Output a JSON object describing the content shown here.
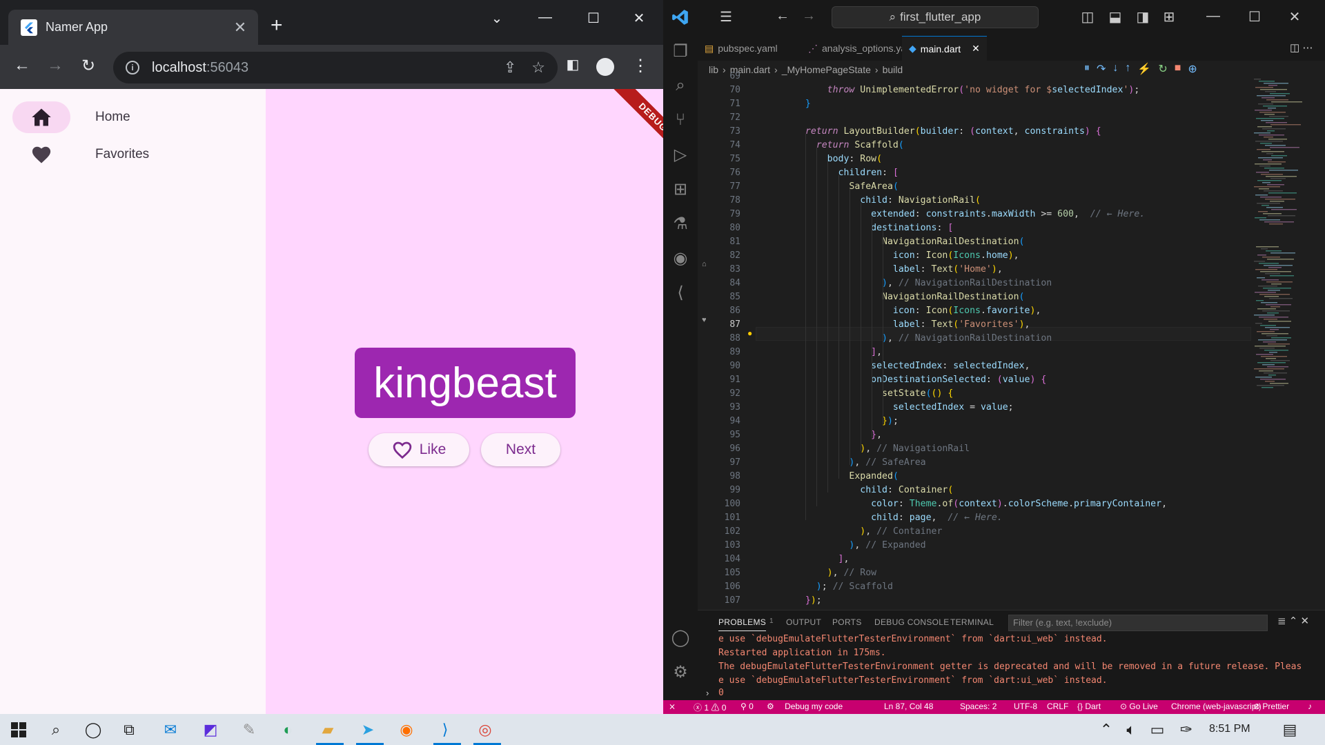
{
  "browser": {
    "tab_title": "Namer App",
    "url_host": "localhost",
    "url_port": ":56043"
  },
  "app": {
    "rail": [
      {
        "label": "Home",
        "icon": "home-icon",
        "selected": true
      },
      {
        "label": "Favorites",
        "icon": "favorite-icon",
        "selected": false
      }
    ],
    "word": "kingbeast",
    "like_label": "Like",
    "next_label": "Next",
    "debug_banner": "DEBUG",
    "colors": {
      "primary": "#9d27b0",
      "container": "#ffd6fe",
      "indicator": "#f8d8f2"
    }
  },
  "vscode": {
    "search": "first_flutter_app",
    "tabs": [
      "pubspec.yaml",
      "analysis_options.yaml",
      "main.dart"
    ],
    "breadcrumb": [
      "lib",
      "main.dart",
      "_MyHomePageState",
      "build"
    ],
    "line_numbers": [
      "69",
      "70",
      "71",
      "72",
      "73",
      "74",
      "75",
      "76",
      "77",
      "78",
      "79",
      "80",
      "81",
      "82",
      "83",
      "84",
      "85",
      "86",
      "87",
      "88",
      "89",
      "90",
      "91",
      "92",
      "93",
      "94",
      "95",
      "96",
      "97",
      "98",
      "99",
      "100",
      "101",
      "102",
      "103",
      "104",
      "105",
      "106",
      "107"
    ],
    "current_line": "87",
    "panel_tabs": [
      "PROBLEMS",
      "1",
      "OUTPUT",
      "PORTS",
      "DEBUG CONSOLE",
      "TERMINAL"
    ],
    "panel_filter": "Filter (e.g. text, !exclude)",
    "console": [
      "e use `debugEmulateFlutterTesterEnvironment` from `dart:ui_web` instead.",
      "Restarted application in 175ms.",
      "The debugEmulateFlutterTesterEnvironment getter is deprecated and will be removed in a future release. Pleas",
      "e use `debugEmulateFlutterTesterEnvironment` from `dart:ui_web` instead.",
      "0"
    ],
    "status": {
      "errors": "1",
      "warnings": "0",
      "ports": "0",
      "debug": "Debug my code",
      "position": "Ln 87, Col 48",
      "spaces": "Spaces: 2",
      "encoding": "UTF-8",
      "eol": "CRLF",
      "language": "Dart",
      "golive": "Go Live",
      "device": "Chrome (web-javascript)",
      "prettier": "Prettier"
    }
  },
  "taskbar": {
    "time": "8:51 PM"
  }
}
